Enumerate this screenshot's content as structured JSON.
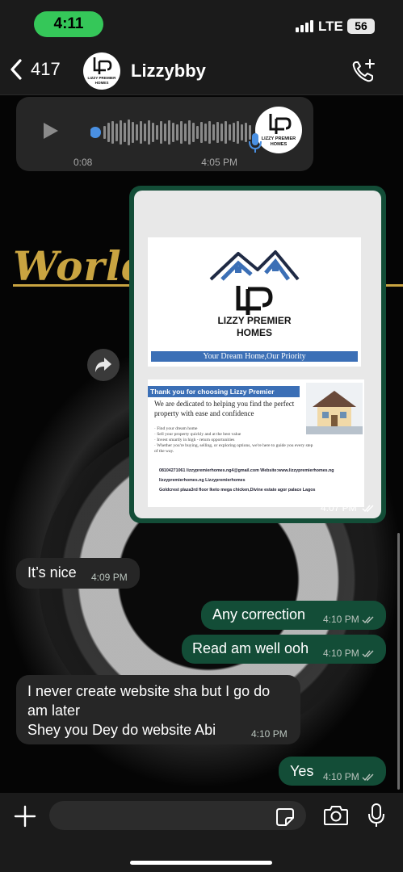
{
  "status_bar": {
    "time": "4:11",
    "network": "LTE",
    "battery": "56"
  },
  "header": {
    "back_count": "417",
    "contact_name": "Lizzybby"
  },
  "wallpaper": {
    "text": "World"
  },
  "messages": {
    "voice": {
      "duration": "0:08",
      "time": "4:05 PM"
    },
    "image": {
      "time": "4:07 PM",
      "brand_line1": "LIZZY PREMIER",
      "brand_line2": "HOMES",
      "tagline": "Your Dream Home,Our Priority",
      "thank_you": "Thank you for choosing Lizzy Premier Homes.",
      "dedicated": "We are dedicated to helping you find the perfect property with ease and confidence",
      "bullets": [
        "· Find your dream home",
        "· Sell your property quickly and at the best value",
        "· Invest smartly in high - return opportunities",
        "· Whether you're buying, selling, or exploring options, we're here to guide you every step of the way."
      ],
      "contact1": "08104271061  lizzypremierhomes.ng4@gmail.com  Website:www.lizzypremierhomes.ng",
      "contact2": "lizzypremierhomes.ng   Lizzypremierhomes",
      "contact3": "Goldcrest plaza3rd floor Iketo mega chicken,Divine estate agor palace Lagos"
    },
    "its_nice": {
      "text": "It’s nice",
      "time": "4:09 PM"
    },
    "any_correction": {
      "text": "Any correction",
      "time": "4:10 PM"
    },
    "read_am": {
      "text": "Read am well ooh",
      "time": "4:10 PM"
    },
    "website": {
      "text": "I never create website sha but I go do\nam later\nShey you Dey do website Abi",
      "time": "4:10 PM"
    },
    "yes": {
      "text": "Yes",
      "time": "4:10 PM"
    }
  },
  "colors": {
    "outgoing": "#134d37",
    "incoming": "#262626",
    "time_pill": "#35c759"
  },
  "icons": [
    "back-chevron-icon",
    "call-add-icon",
    "play-icon",
    "mic-icon",
    "forward-icon",
    "plus-icon",
    "sticker-icon",
    "camera-icon",
    "read-receipt-icon"
  ]
}
